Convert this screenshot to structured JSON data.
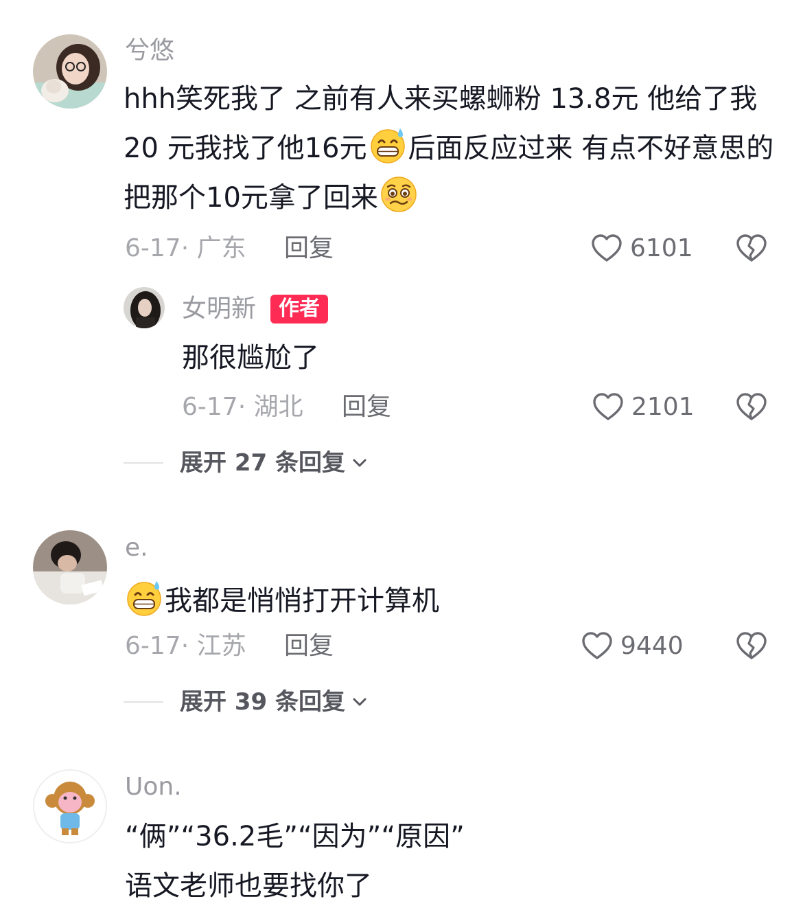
{
  "comments": [
    {
      "username": "兮悠",
      "avatar_icon": "avatar-girl-with-cat",
      "text_parts": [
        "hhh笑死我了  之前有人来买螺蛳粉 13.8元 他给了我20 元我找了他16元",
        "后面反应过来 有点不好意思的把那个10元拿了回来",
        ""
      ],
      "date_location": "6-17· 广东",
      "reply_label": "回复",
      "likes": "6101",
      "replies": [
        {
          "username": "女明新",
          "badge": "作者",
          "avatar_icon": "avatar-dark-hair-woman",
          "text": "那很尴尬了",
          "date_location": "6-17· 湖北",
          "reply_label": "回复",
          "likes": "2101"
        }
      ],
      "expand_label": "展开 27 条回复"
    },
    {
      "username": "e.",
      "avatar_icon": "avatar-person-writing",
      "text": "我都是悄悄打开计算机",
      "date_location": "6-17· 江苏",
      "reply_label": "回复",
      "likes": "9440",
      "expand_label": "展开 39 条回复"
    },
    {
      "username": "Uon.",
      "avatar_icon": "avatar-cartoon-monkey",
      "text_line1": "“俩”“36.2毛”“因为”“原因”",
      "text_line2": "语文老师也要找你了"
    }
  ],
  "colors": {
    "accent": "#fe2c55",
    "text": "#161823",
    "muted": "#a6a7ac"
  }
}
